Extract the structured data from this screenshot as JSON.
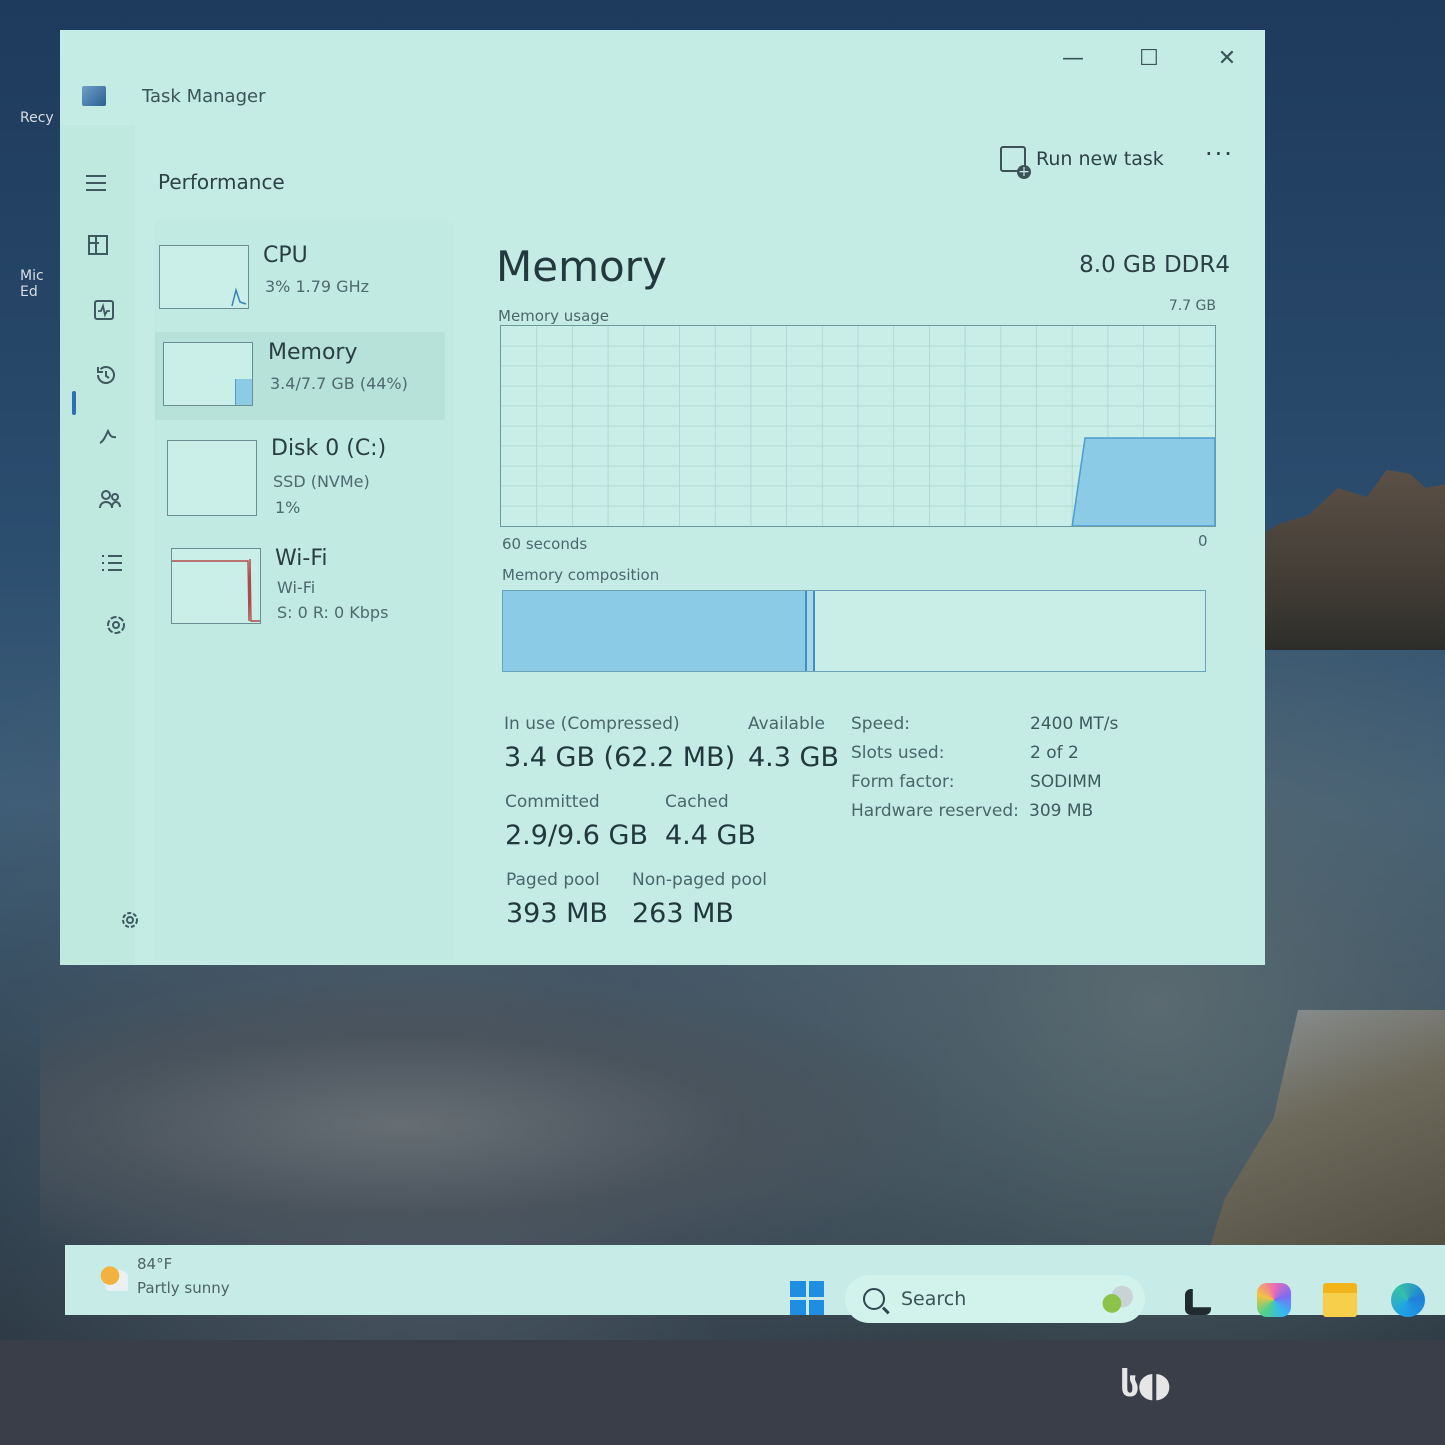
{
  "desktop": {
    "icons": [
      {
        "label": "Recy"
      },
      {
        "label": "Mic\nEd"
      }
    ]
  },
  "window": {
    "title": "Task Manager",
    "controls": {
      "minimize": "—",
      "maximize": "☐",
      "close": "✕"
    }
  },
  "header": {
    "page_title": "Performance",
    "run_new_task": "Run new task",
    "more": "···"
  },
  "nav_icons": [
    "hamburger-icon",
    "processes-icon",
    "performance-icon",
    "app-history-icon",
    "startup-apps-icon",
    "users-icon",
    "details-icon",
    "services-icon",
    "settings-icon"
  ],
  "sidebar": {
    "tiles": [
      {
        "name": "CPU",
        "sub1": "3%  1.79 GHz",
        "sub2": ""
      },
      {
        "name": "Memory",
        "sub1": "3.4/7.7 GB (44%)",
        "sub2": ""
      },
      {
        "name": "Disk 0 (C:)",
        "sub1": "SSD (NVMe)",
        "sub2": "1%"
      },
      {
        "name": "Wi-Fi",
        "sub1": "Wi-Fi",
        "sub2": "S: 0 R: 0 Kbps"
      }
    ]
  },
  "memory": {
    "title": "Memory",
    "spec": "8.0 GB DDR4",
    "usage_label": "Memory usage",
    "usage_max": "7.7 GB",
    "time_label": "60 seconds",
    "zero_label": "0",
    "usage_fraction": 0.44,
    "composition_label": "Memory composition",
    "composition": {
      "in_use_fraction": 0.43,
      "modified_fraction": 0.015
    },
    "stats": {
      "in_use_label": "In use (Compressed)",
      "in_use": "3.4 GB (62.2 MB)",
      "available_label": "Available",
      "available": "4.3 GB",
      "committed_label": "Committed",
      "committed": "2.9/9.6 GB",
      "cached_label": "Cached",
      "cached": "4.4 GB",
      "paged_label": "Paged pool",
      "paged": "393 MB",
      "nonpaged_label": "Non-paged pool",
      "nonpaged": "263 MB"
    },
    "specs": [
      {
        "label": "Speed:",
        "value": "2400 MT/s"
      },
      {
        "label": "Slots used:",
        "value": "2 of 2"
      },
      {
        "label": "Form factor:",
        "value": "SODIMM"
      },
      {
        "label": "Hardware reserved:",
        "value": "309 MB"
      }
    ]
  },
  "taskbar": {
    "weather_temp": "84°F",
    "weather_desc": "Partly sunny",
    "search_label": "Search"
  },
  "colors": {
    "accent": "#2f6fb0",
    "memory_fill": "#8ccbe6",
    "memory_line": "#4c9bd0",
    "window_bg": "#c4ece4"
  }
}
